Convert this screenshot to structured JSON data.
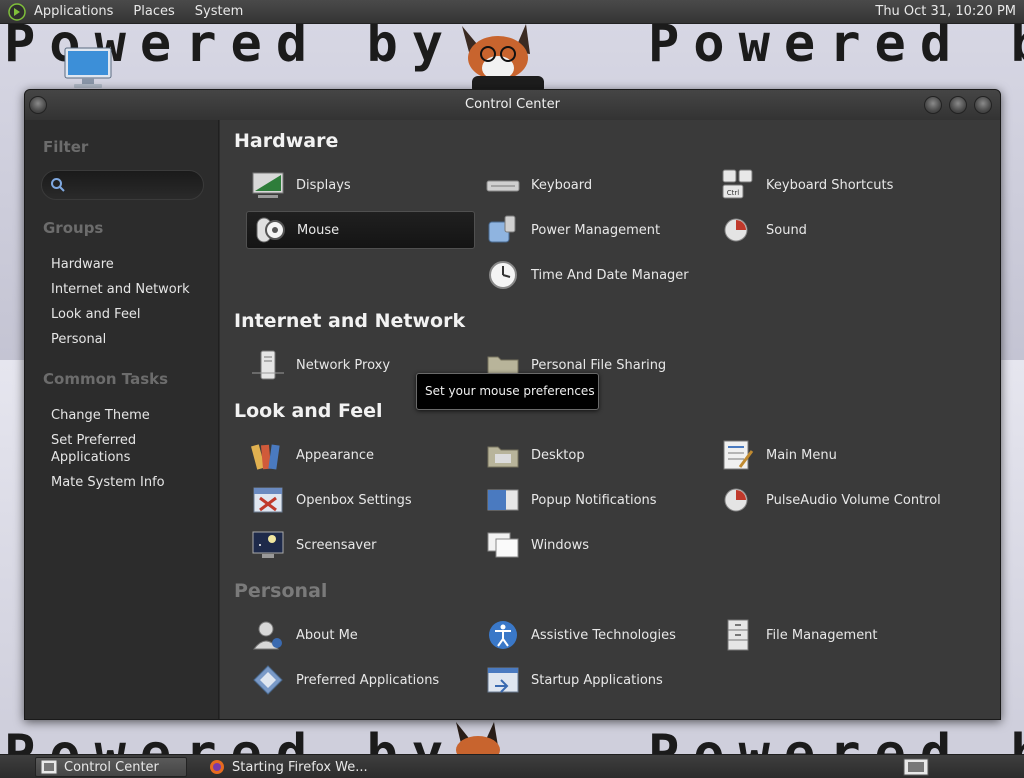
{
  "top_panel": {
    "menus": [
      "Applications",
      "Places",
      "System"
    ],
    "clock": "Thu Oct 31, 10:20 PM"
  },
  "wallpaper": {
    "text": "Powered by"
  },
  "window": {
    "title": "Control Center"
  },
  "sidebar": {
    "filter_heading": "Filter",
    "search_placeholder": "",
    "groups_heading": "Groups",
    "groups": [
      "Hardware",
      "Internet and Network",
      "Look and Feel",
      "Personal"
    ],
    "tasks_heading": "Common Tasks",
    "tasks": [
      "Change Theme",
      "Set Preferred Applications",
      "Mate System Info"
    ]
  },
  "sections": {
    "hardware": {
      "title": "Hardware",
      "items": [
        "Displays",
        "Keyboard",
        "Keyboard Shortcuts",
        "Mouse",
        "Power Management",
        "Sound",
        "Time And Date Manager"
      ]
    },
    "internet": {
      "title": "Internet and Network",
      "items": [
        "Network Proxy",
        "Personal File Sharing"
      ]
    },
    "look": {
      "title": "Look and Feel",
      "items": [
        "Appearance",
        "Desktop",
        "Main Menu",
        "Openbox Settings",
        "Popup Notifications",
        "PulseAudio Volume Control",
        "Screensaver",
        "Windows"
      ]
    },
    "personal": {
      "title": "Personal",
      "items": [
        "About Me",
        "Assistive Technologies",
        "File Management",
        "Preferred Applications",
        "Startup Applications"
      ]
    }
  },
  "tooltip": "Set your mouse preferences",
  "bottom_panel": {
    "tasks": [
      "Control Center",
      "Starting Firefox We..."
    ]
  },
  "colors": {
    "window_bg": "#3a3a3a",
    "sidebar_bg": "#2c2c2c",
    "panel_bg": "#343434",
    "heading_dim": "#6c6c6c"
  }
}
